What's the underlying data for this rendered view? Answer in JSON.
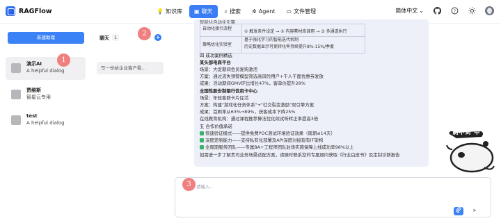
{
  "brand": {
    "name": "RAGFlow"
  },
  "nav": {
    "items": [
      {
        "label": "知识库",
        "icon": "lightbulb-icon"
      },
      {
        "label": "聊天",
        "icon": "chat-icon",
        "active": true
      },
      {
        "label": "搜索",
        "icon": "search-icon"
      },
      {
        "label": "Agent",
        "icon": "agent-icon"
      },
      {
        "label": "文件管理",
        "icon": "folder-icon"
      }
    ]
  },
  "toolbar": {
    "language": "简体中文",
    "language_caret": "⌄"
  },
  "sidebar": {
    "new_button": "新建助理",
    "assistants": [
      {
        "name": "演示AI",
        "desc": "A helpful dialog",
        "selected": true
      },
      {
        "name": "贾维斯",
        "desc": "智星云专用"
      },
      {
        "name": "test",
        "desc": "A helpful dialog"
      }
    ]
  },
  "conversations": {
    "title": "聊天",
    "count": "1",
    "items": [
      "写一份给企业客户看..."
    ]
  },
  "markers": [
    "1",
    "2",
    "3"
  ],
  "message": {
    "table_rows": [
      [
        "自动化接引流程",
        "① 触发条件设定 → ② 内容素材库调用 → ③ 多通道执行"
      ],
      [
        "策略优化实验室",
        "基于强化学习的智能迭代机制",
        "历史数据显示可使转化率持续提升8%-15%/季度"
      ]
    ],
    "top_partial": "智能化自动化引擎",
    "section4_title": "四 成功案例精选",
    "case1_title": "某头部电商平台",
    "case1_lines": [
      "场景：大促期间会员复购激活",
      "方案：通过流失预警模型筛选高风险用户+千人千面优惠券发放",
      "成果：活动期间GMV环比增长47%，客单价提升28%"
    ],
    "case2_title": "全国性股份制银行信用卡中心",
    "case2_lines": [
      "场景：年轻客群卡片促活",
      "方案：构建\"游戏化任务体系\"+\"社交裂变激励\"双引擎方案",
      "成果：首刷率从63%→89%，获客成本下降25%",
      "在线教育机构：通过课程推荐算法优化续试听转正率提高3倍"
    ],
    "section5_title": "五 合作价值承诺",
    "commitments": [
      "快速验证模式——提供免费POC测试环境验证效果（周期≤14天）",
      "深度定制能力——支持私有化部署及API深度对接现有IT架构",
      "全周期服务团队——专属BA+工程师团队驻场实施保障上线成功率98%以上"
    ],
    "closing": "如需进一步了解贵司业务场景适配方案，请随时联系您的专属顾问获取《行业白皮书》及定制诊断报告"
  },
  "input": {
    "placeholder": "请输入..."
  },
  "sticker": {
    "caption": "S 刷不到 中 !"
  },
  "colors": {
    "accent": "#3b82f6",
    "marker": "#f07f7f",
    "bubble": "#eef0f9"
  }
}
